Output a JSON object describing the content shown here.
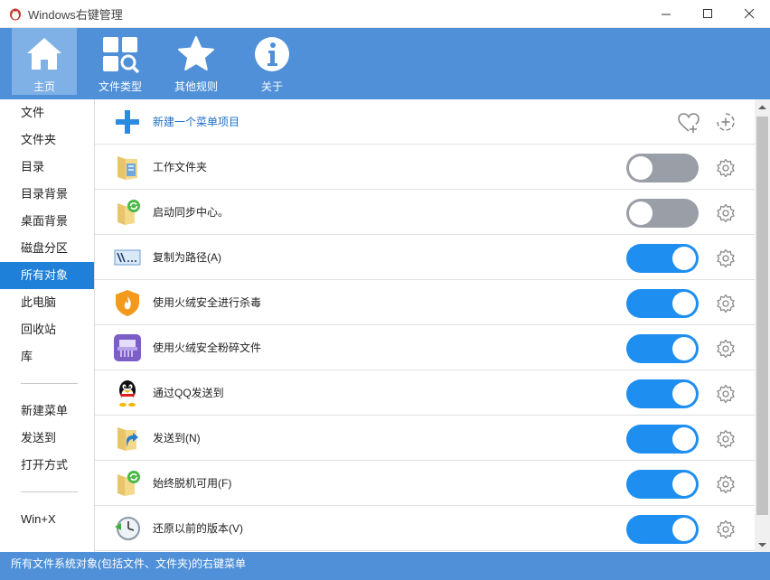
{
  "window": {
    "title": "Windows右键管理",
    "icon": "penguin-icon"
  },
  "toolbar": {
    "items": [
      {
        "label": "主页",
        "icon": "home-icon",
        "active": true
      },
      {
        "label": "文件类型",
        "icon": "file-types-icon",
        "active": false
      },
      {
        "label": "其他规则",
        "icon": "star-icon",
        "active": false
      },
      {
        "label": "关于",
        "icon": "info-icon",
        "active": false
      }
    ]
  },
  "sidebar": {
    "group1": [
      "文件",
      "文件夹",
      "目录",
      "目录背景",
      "桌面背景",
      "磁盘分区",
      "所有对象",
      "此电脑",
      "回收站",
      "库"
    ],
    "group2": [
      "新建菜单",
      "发送到",
      "打开方式"
    ],
    "group3": [
      "Win+X"
    ],
    "active": "所有对象"
  },
  "content": {
    "new_item": {
      "label": "新建一个菜单项目",
      "icon": "blue-plus-icon"
    },
    "rows": [
      {
        "label": "工作文件夹",
        "icon": "work-folder-icon",
        "enabled": false
      },
      {
        "label": "启动同步中心。",
        "icon": "sync-center-icon",
        "enabled": false
      },
      {
        "label": "复制为路径(A)",
        "icon": "copy-path-icon",
        "enabled": true
      },
      {
        "label": "使用火绒安全进行杀毒",
        "icon": "huorong-shield-icon",
        "enabled": true
      },
      {
        "label": "使用火绒安全粉碎文件",
        "icon": "file-shredder-icon",
        "enabled": true
      },
      {
        "label": "通过QQ发送到",
        "icon": "qq-penguin-icon",
        "enabled": true
      },
      {
        "label": "发送到(N)",
        "icon": "send-to-icon",
        "enabled": true
      },
      {
        "label": "始终脱机可用(F)",
        "icon": "offline-sync-icon",
        "enabled": true
      },
      {
        "label": "还原以前的版本(V)",
        "icon": "restore-clock-icon",
        "enabled": true
      }
    ]
  },
  "statusbar": {
    "text": "所有文件系统对象(包括文件、文件夹)的右键菜单"
  },
  "colors": {
    "accent": "#4f90d9",
    "toggle_on": "#1e8ef0",
    "toggle_off": "#9a9ea6",
    "sidebar_active": "#1e80d8"
  }
}
